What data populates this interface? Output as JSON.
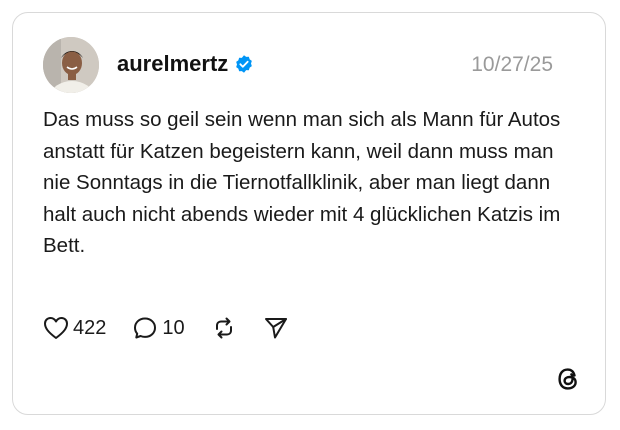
{
  "post": {
    "username": "aurelmertz",
    "verified": true,
    "date": "10/27/25",
    "text": "Das muss so geil sein wenn man sich als Mann für Autos anstatt für Katzen begeistern kann, weil dann muss man nie Sonntags in die Tiernotfallklinik, aber man liegt dann halt auch nicht abends wieder mit 4 glücklichen Katzis im Bett."
  },
  "actions": {
    "likes": "422",
    "replies": "10"
  },
  "icons": {
    "verified": "verified-badge-icon",
    "like": "heart-icon",
    "reply": "speech-bubble-icon",
    "repost": "repost-icon",
    "share": "send-icon",
    "brand": "threads-logo-icon"
  },
  "colors": {
    "verified_badge": "#0095f6",
    "date": "#9a9a9a",
    "border": "#d9d9d9"
  }
}
